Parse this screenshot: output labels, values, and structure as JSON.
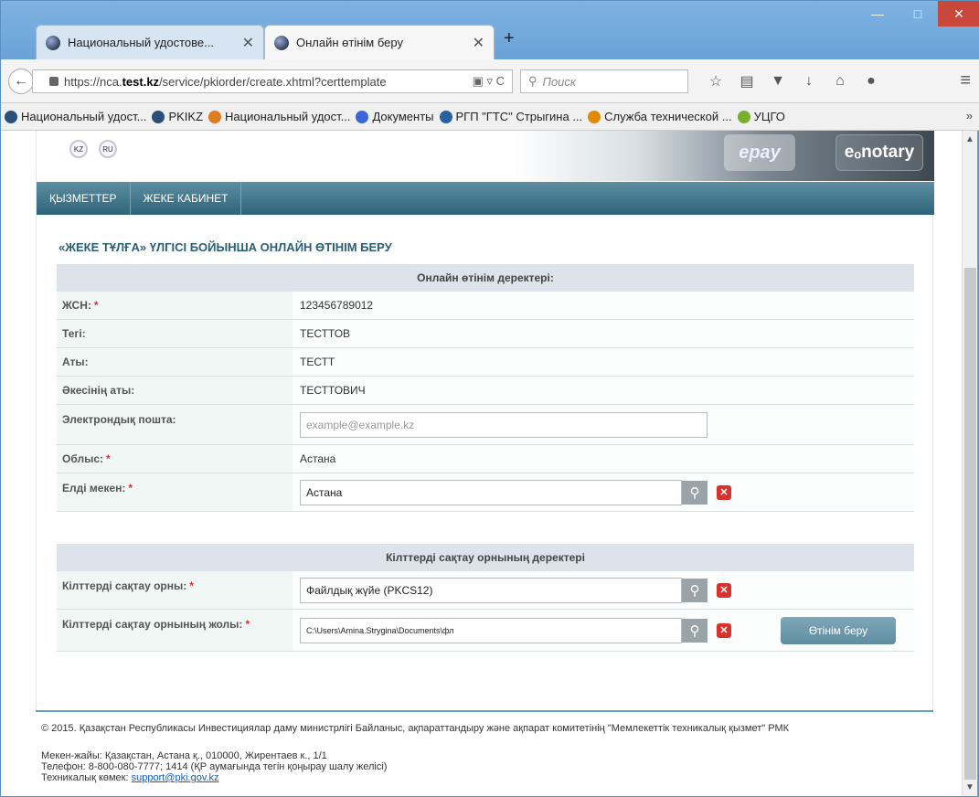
{
  "browser": {
    "tabs": [
      {
        "label": "Национальный удостове..."
      },
      {
        "label": "Онлайн өтінім беру"
      }
    ],
    "new_tab": "+",
    "url_prefix": "https://nca.",
    "url_domain": "test.kz",
    "url_suffix": "/service/pkiorder/create.xhtml?certtemplate",
    "search_placeholder": "Поиск",
    "bookmarks": [
      {
        "label": "Национальный удост...",
        "color": "#2a4f7a"
      },
      {
        "label": "PKIKZ",
        "color": "#2a4f7a"
      },
      {
        "label": "Национальный удост...",
        "color": "#e07b20"
      },
      {
        "label": "Документы",
        "color": "#3a66d6"
      },
      {
        "label": "РГП \"ГТС\" Стрыгина ...",
        "color": "#2a5fa0"
      },
      {
        "label": "Служба технической ...",
        "color": "#e08a00"
      },
      {
        "label": "УЦГО",
        "color": "#7ab030"
      }
    ],
    "more": "»"
  },
  "page": {
    "lang_kz": "KZ",
    "lang_ru": "RU",
    "epay": "epay",
    "enotary": "eₒnotary",
    "nav": [
      "ҚЫЗМЕТТЕР",
      "ЖЕКЕ КАБИНЕТ"
    ],
    "form_title": "«ЖЕКЕ ТҰЛҒА» ҮЛГІСІ БОЙЫНША ОНЛАЙН ӨТІНІМ БЕРУ",
    "section1": "Онлайн өтінім деректері:",
    "iin_label": "ЖСН:",
    "iin_value": "123456789012",
    "surname_label": "Тегі:",
    "surname_value": "ТЕСТТОВ",
    "name_label": "Аты:",
    "name_value": "ТЕСТТ",
    "patronymic_label": "Әкесінің аты:",
    "patronymic_value": "ТЕСТТОВИЧ",
    "email_label": "Электрондық пошта:",
    "email_placeholder": "example@example.kz",
    "region_label": "Облыс:",
    "region_value": "Астана",
    "locality_label": "Елді мекен:",
    "locality_value": "Астана",
    "section2": "Кілттерді сақтау орнының деректері",
    "storage_label": "Кілттерді сақтау орны:",
    "storage_value": "Файлдық жүйе (PKCS12)",
    "path_label": "Кілттерді сақтау орнының жолы:",
    "path_value": "C:\\Users\\Amina.Strygina\\Documents\\фл",
    "submit": "Өтінім беру",
    "required_mark": "*"
  },
  "footer": {
    "copyright": "© 2015. Қазақстан Республикасы Инвестициялар даму министрлігі Байланыс, ақпараттандыру және ақпарат комитетінің \"Мемлекеттік техникалық қызмет\" РМК",
    "address": "Мекен-жайы: Қазақстан, Астана қ., 010000, Жирентаев к., 1/1",
    "phone": "Телефон: 8-800-080-7777; 1414 (ҚР аумағында тегін қоңырау шалу желісі)",
    "support_label": "Техникалық көмек:",
    "support_email": "support@pki.gov.kz"
  }
}
